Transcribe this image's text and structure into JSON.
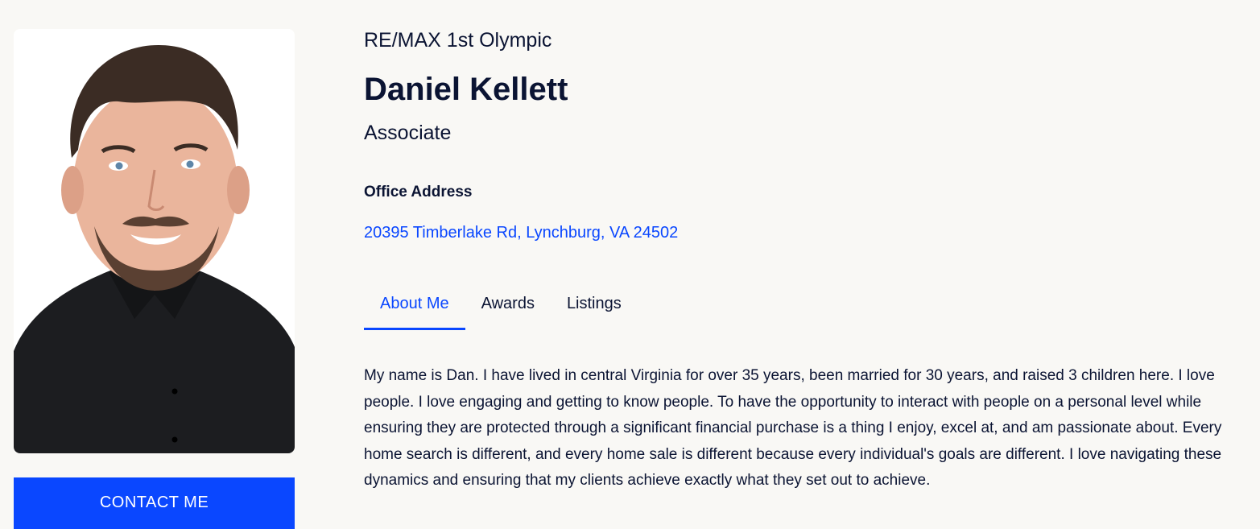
{
  "agent": {
    "brokerage": "RE/MAX 1st Olympic",
    "name": "Daniel Kellett",
    "title": "Associate",
    "office_address_label": "Office Address",
    "office_address": "20395 Timberlake Rd, Lynchburg, VA 24502"
  },
  "contact": {
    "button_label": "CONTACT ME"
  },
  "tabs": [
    {
      "label": "About Me",
      "active": true
    },
    {
      "label": "Awards",
      "active": false
    },
    {
      "label": "Listings",
      "active": false
    }
  ],
  "about": {
    "text": "My name is Dan. I have lived in central Virginia for over 35 years, been married for 30 years, and raised 3 children here. I love people. I love engaging and getting to know people. To have the opportunity to interact with people on a personal level while ensuring they are protected through a significant financial purchase is a thing I enjoy, excel at, and am passionate about. Every home search is different, and every home sale is different because every individual's goals are different. I love navigating these dynamics and ensuring that my clients achieve exactly what they set out to achieve."
  },
  "colors": {
    "accent": "#0a47ff",
    "text": "#0b1433",
    "background": "#f9f8f5"
  }
}
